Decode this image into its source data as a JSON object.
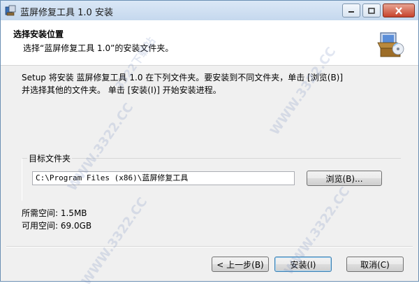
{
  "window": {
    "title": "蓝屏修复工具 1.0 安装",
    "min_icon": "minimize-icon",
    "max_icon": "maximize-icon",
    "close_icon": "close-icon"
  },
  "header": {
    "title": "选择安装位置",
    "subtitle": "选择“蓝屏修复工具 1.0”的安装文件夹。",
    "icon": "installer-box-icon"
  },
  "body": {
    "line1": "Setup 将安装 蓝屏修复工具 1.0 在下列文件夹。要安装到不同文件夹，单击 [浏览(B)]",
    "line2": "并选择其他的文件夹。 单击 [安装(I)] 开始安装进程。"
  },
  "destination": {
    "group_label": "目标文件夹",
    "path_value": "C:\\Program Files (x86)\\蓝屏修复工具",
    "browse_label": "浏览(B)..."
  },
  "space": {
    "required": "所需空间: 1.5MB",
    "available": "可用空间: 69.0GB"
  },
  "buttons": {
    "back": "< 上一步(B)",
    "install": "安装(I)",
    "cancel": "取消(C)"
  },
  "watermark": {
    "text": "WWW.3322.CC",
    "text2": "3322下载站"
  },
  "colors": {
    "accent": "#3c7fb1",
    "close": "#c7432c"
  }
}
